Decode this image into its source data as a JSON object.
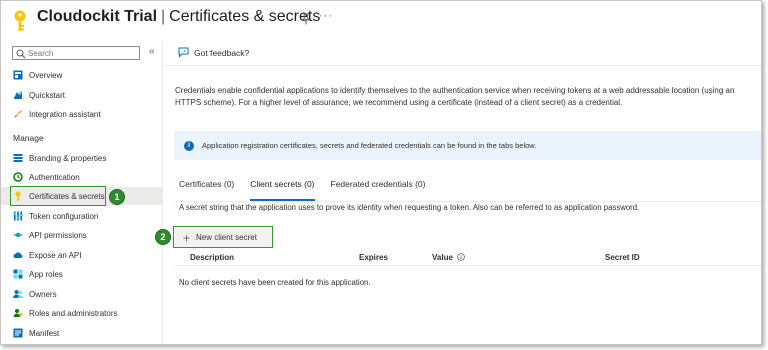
{
  "header": {
    "app_name": "Cloudockit Trial",
    "separator": "|",
    "page_title": "Certificates & secrets",
    "more_label": "···"
  },
  "sidebar": {
    "search_placeholder": "Search",
    "collapse_label": "«",
    "items_top": [
      {
        "label": "Overview",
        "icon": "overview-icon"
      },
      {
        "label": "Quickstart",
        "icon": "quickstart-icon"
      },
      {
        "label": "Integration assistant",
        "icon": "rocket-icon"
      }
    ],
    "manage_title": "Manage",
    "items_manage": [
      {
        "label": "Branding & properties",
        "icon": "branding-icon"
      },
      {
        "label": "Authentication",
        "icon": "authentication-icon"
      },
      {
        "label": "Certificates & secrets",
        "icon": "key-icon",
        "active": true
      },
      {
        "label": "Token configuration",
        "icon": "token-icon"
      },
      {
        "label": "API permissions",
        "icon": "api-permissions-icon"
      },
      {
        "label": "Expose an API",
        "icon": "cloud-icon"
      },
      {
        "label": "App roles",
        "icon": "app-roles-icon"
      },
      {
        "label": "Owners",
        "icon": "owners-icon"
      },
      {
        "label": "Roles and administrators",
        "icon": "roles-icon"
      },
      {
        "label": "Manifest",
        "icon": "manifest-icon"
      }
    ]
  },
  "callouts": [
    "1",
    "2"
  ],
  "toolbar": {
    "feedback_label": "Got feedback?"
  },
  "main": {
    "intro": "Credentials enable confidential applications to identify themselves to the authentication service when receiving tokens at a web addressable location (using an HTTPS scheme). For a higher level of assurance, we recommend using a certificate (instead of a client secret) as a credential.",
    "info_text": "Application registration certificates, secrets and federated credentials can be found in the tabs below.",
    "tabs": [
      {
        "label": "Certificates (0)"
      },
      {
        "label": "Client secrets (0)",
        "active": true
      },
      {
        "label": "Federated credentials (0)"
      }
    ],
    "tab_description": "A secret string that the application uses to prove its identity when requesting a token. Also can be referred to as application password.",
    "new_secret_label": "New client secret",
    "columns": [
      "Description",
      "Expires",
      "Value",
      "Secret ID"
    ],
    "empty_message": "No client secrets have been created for this application."
  },
  "colors": {
    "accent": "#0f6cbd",
    "callout_green": "#2e8b2e",
    "key_yellow": "#f2c811",
    "info_background": "#ebf3fc"
  }
}
